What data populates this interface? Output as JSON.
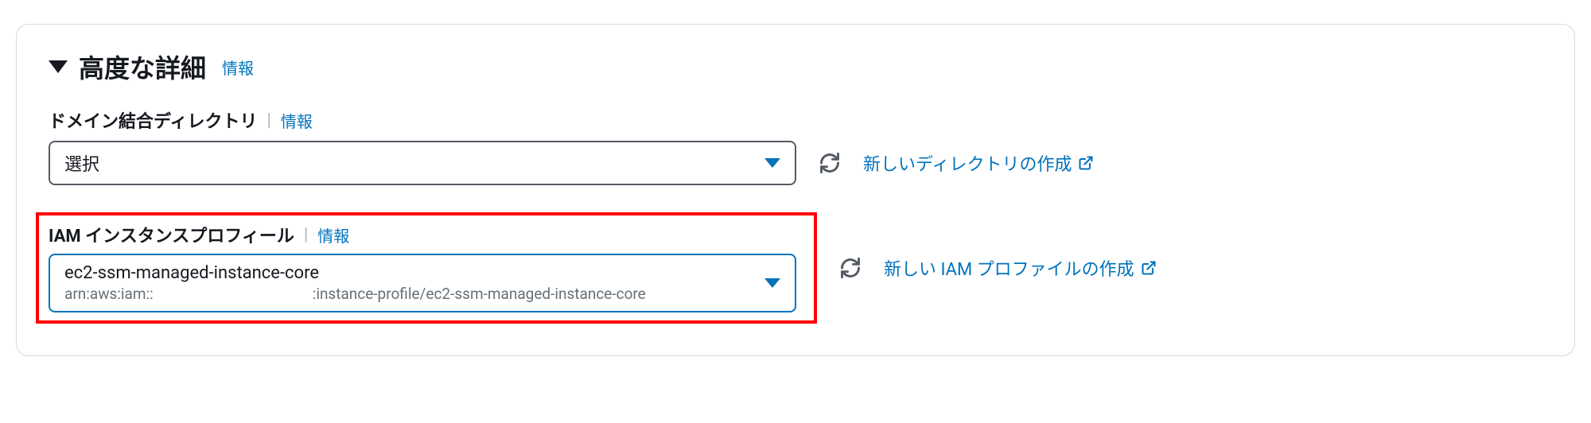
{
  "section": {
    "title": "高度な詳細",
    "info_label": "情報"
  },
  "domain_join": {
    "label": "ドメイン結合ディレクトリ",
    "info_label": "情報",
    "placeholder": "選択",
    "create_link": "新しいディレクトリの作成"
  },
  "iam_profile": {
    "label": "IAM インスタンスプロフィール",
    "info_label": "情報",
    "selected_value": "ec2-ssm-managed-instance-core",
    "arn_prefix": "arn:aws:iam::",
    "arn_suffix": ":instance-profile/ec2-ssm-managed-instance-core",
    "create_link": "新しい IAM プロファイルの作成"
  }
}
